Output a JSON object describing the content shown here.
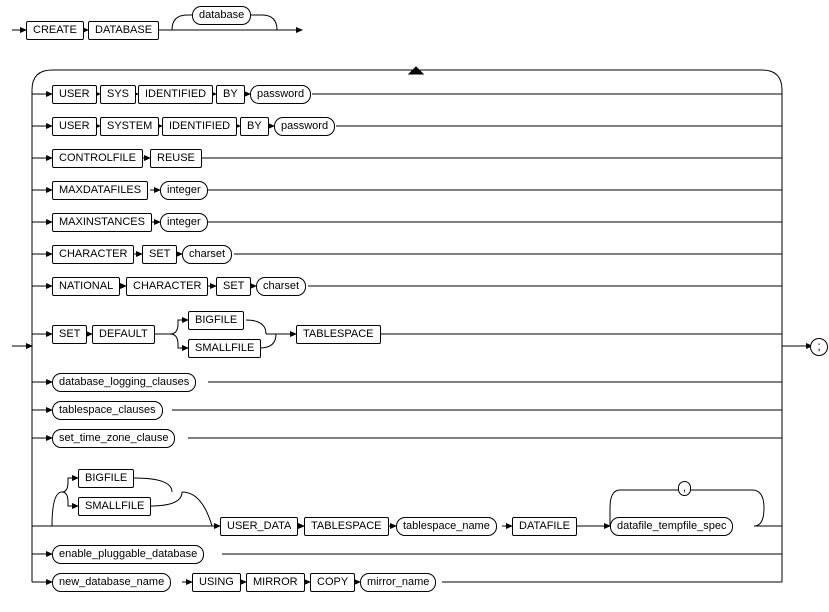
{
  "top": {
    "create": "CREATE",
    "database": "DATABASE",
    "database_name": "database"
  },
  "r1": {
    "user": "USER",
    "sys": "SYS",
    "identified": "IDENTIFIED",
    "by": "BY",
    "password": "password"
  },
  "r2": {
    "user": "USER",
    "system": "SYSTEM",
    "identified": "IDENTIFIED",
    "by": "BY",
    "password": "password"
  },
  "r3": {
    "controlfile": "CONTROLFILE",
    "reuse": "REUSE"
  },
  "r4": {
    "maxdatafiles": "MAXDATAFILES",
    "integer": "integer"
  },
  "r5": {
    "maxinstances": "MAXINSTANCES",
    "integer": "integer"
  },
  "r6": {
    "character": "CHARACTER",
    "set": "SET",
    "charset": "charset"
  },
  "r7": {
    "national": "NATIONAL",
    "character": "CHARACTER",
    "set": "SET",
    "charset": "charset"
  },
  "r8": {
    "set": "SET",
    "default": "DEFAULT",
    "bigfile": "BIGFILE",
    "smallfile": "SMALLFILE",
    "tablespace": "TABLESPACE"
  },
  "r9": {
    "clause": "database_logging_clauses"
  },
  "r10": {
    "clause": "tablespace_clauses"
  },
  "r11": {
    "clause": "set_time_zone_clause"
  },
  "r12": {
    "bigfile": "BIGFILE",
    "smallfile": "SMALLFILE",
    "user_data": "USER_DATA",
    "tablespace": "TABLESPACE",
    "tablespace_name": "tablespace_name",
    "datafile": "DATAFILE",
    "spec": "datafile_tempfile_spec",
    "comma": ","
  },
  "r13": {
    "clause": "enable_pluggable_database"
  },
  "r14": {
    "new_db": "new_database_name",
    "using": "USING",
    "mirror": "MIRROR",
    "copy": "COPY",
    "mirror_name": "mirror_name"
  },
  "semi": ";",
  "chart_data": {
    "type": "diagram",
    "title": "CREATE DATABASE syntax railroad diagram",
    "root_sequence": [
      "CREATE",
      "DATABASE",
      {
        "optional": "database"
      }
    ],
    "optional_repeating_clauses": [
      [
        "USER",
        "SYS",
        "IDENTIFIED",
        "BY",
        "password"
      ],
      [
        "USER",
        "SYSTEM",
        "IDENTIFIED",
        "BY",
        "password"
      ],
      [
        "CONTROLFILE",
        "REUSE"
      ],
      [
        "MAXDATAFILES",
        "integer"
      ],
      [
        "MAXINSTANCES",
        "integer"
      ],
      [
        "CHARACTER",
        "SET",
        "charset"
      ],
      [
        "NATIONAL",
        "CHARACTER",
        "SET",
        "charset"
      ],
      [
        "SET",
        "DEFAULT",
        {
          "choice": [
            "BIGFILE",
            "SMALLFILE"
          ]
        },
        "TABLESPACE"
      ],
      [
        "database_logging_clauses"
      ],
      [
        "tablespace_clauses"
      ],
      [
        "set_time_zone_clause"
      ],
      [
        {
          "optional_choice": [
            "BIGFILE",
            "SMALLFILE"
          ]
        },
        "USER_DATA",
        "TABLESPACE",
        "tablespace_name",
        "DATAFILE",
        {
          "repeat_sep": ",",
          "item": "datafile_tempfile_spec"
        }
      ],
      [
        "enable_pluggable_database"
      ],
      [
        "new_database_name",
        "USING",
        "MIRROR",
        "COPY",
        "mirror_name"
      ]
    ],
    "terminator": ";"
  }
}
